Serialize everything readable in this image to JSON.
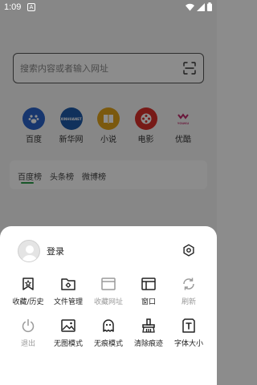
{
  "status": {
    "time": "1:09",
    "notif_letter": "A"
  },
  "search": {
    "placeholder": "搜索内容或者输入网址"
  },
  "shortcuts": [
    {
      "label": "百度",
      "color": "#2b63c8",
      "icon": "baidu-paw"
    },
    {
      "label": "新华网",
      "color": "#1e5aa8",
      "icon": "xinhua-logo",
      "icon_text": "XINHUANET"
    },
    {
      "label": "小说",
      "color": "#e0a21a",
      "icon": "book"
    },
    {
      "label": "电影",
      "color": "#d9302b",
      "icon": "film-reel"
    },
    {
      "label": "优酷",
      "color": "#e8e8e8",
      "icon": "youku-logo",
      "icon_text": "YOUKU"
    }
  ],
  "rank_tabs": [
    "百度榜",
    "头条榜",
    "微博榜"
  ],
  "sheet": {
    "login_label": "登录",
    "items": [
      {
        "label": "收藏/历史",
        "icon": "bookmark-star-icon",
        "disabled": false
      },
      {
        "label": "文件管理",
        "icon": "folder-gear-icon",
        "disabled": false
      },
      {
        "label": "收藏网址",
        "icon": "window-icon",
        "disabled": true
      },
      {
        "label": "窗口",
        "icon": "panel-icon",
        "disabled": false
      },
      {
        "label": "刷新",
        "icon": "refresh-icon",
        "disabled": true
      },
      {
        "label": "退出",
        "icon": "power-icon",
        "disabled": true
      },
      {
        "label": "无图模式",
        "icon": "image-icon",
        "disabled": false
      },
      {
        "label": "无痕模式",
        "icon": "ghost-icon",
        "disabled": false
      },
      {
        "label": "清除痕迹",
        "icon": "broom-icon",
        "disabled": false
      },
      {
        "label": "字体大小",
        "icon": "font-size-icon",
        "disabled": false
      }
    ]
  },
  "colors": {
    "accent": "#2a9d4a",
    "disabled": "#9a9a9a"
  }
}
